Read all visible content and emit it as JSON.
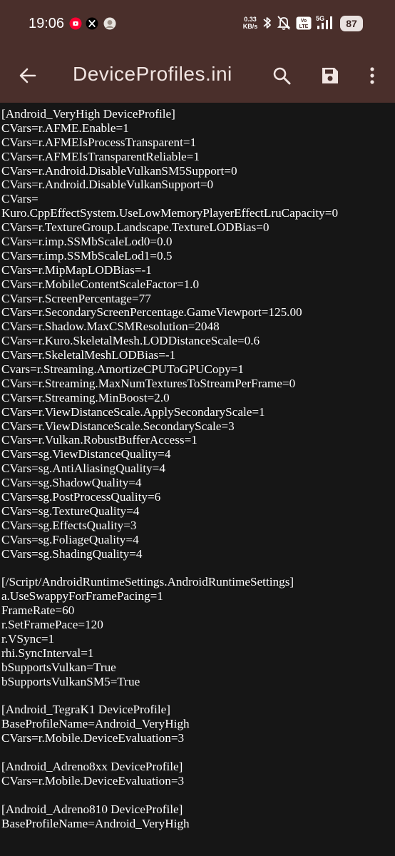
{
  "status_bar": {
    "time": "19:06",
    "net_speed_value": "0.33",
    "net_speed_unit": "KB/s",
    "signal_label": "5G",
    "volte_label": "Vo LTE",
    "battery": "87",
    "notification_icons": [
      "youtube-icon",
      "x-icon",
      "avatar-icon"
    ],
    "status_icons": [
      "bluetooth-icon",
      "mute-icon",
      "volte-icon",
      "5g-signal-icon",
      "battery-icon"
    ]
  },
  "app_bar": {
    "title": "DeviceProfiles.ini",
    "back_icon": "back-arrow-icon",
    "search_icon": "search-icon",
    "save_icon": "save-icon",
    "menu_icon": "more-vertical-icon"
  },
  "colors": {
    "bar_background": "#4a2f2b",
    "editor_background": "#161616",
    "text": "#ffffff",
    "youtube_red": "#ff0033"
  },
  "editor": {
    "lines": [
      "[Android_VeryHigh DeviceProfile]",
      "CVars=r.AFME.Enable=1",
      "CVars=r.AFMEIsProcessTransparent=1",
      "CVars=r.AFMEIsTransparentReliable=1",
      "CVars=r.Android.DisableVulkanSM5Support=0",
      "CVars=r.Android.DisableVulkanSupport=0",
      "CVars=",
      "Kuro.CppEffectSystem.UseLowMemoryPlayerEffectLruCapacity=0",
      "CVars=r.TextureGroup.Landscape.TextureLODBias=0",
      "CVars=r.imp.SSMbScaleLod0=0.0",
      "CVars=r.imp.SSMbScaleLod1=0.5",
      "CVars=r.MipMapLODBias=-1",
      "CVars=r.MobileContentScaleFactor=1.0",
      "CVars=r.ScreenPercentage=77",
      "CVars=r.SecondaryScreenPercentage.GameViewport=125.00",
      "CVars=r.Shadow.MaxCSMResolution=2048",
      "CVars=r.Kuro.SkeletalMesh.LODDistanceScale=0.6",
      "CVars=r.SkeletalMeshLODBias=-1",
      "Cvars=r.Streaming.AmortizeCPUToGPUCopy=1",
      "CVars=r.Streaming.MaxNumTexturesToStreamPerFrame=0",
      "CVars=r.Streaming.MinBoost=2.0",
      "CVars=r.ViewDistanceScale.ApplySecondaryScale=1",
      "CVars=r.ViewDistanceScale.SecondaryScale=3",
      "CVars=r.Vulkan.RobustBufferAccess=1",
      "CVars=sg.ViewDistanceQuality=4",
      "CVars=sg.AntiAliasingQuality=4",
      "CVars=sg.ShadowQuality=4",
      "CVars=sg.PostProcessQuality=6",
      "CVars=sg.TextureQuality=4",
      "CVars=sg.EffectsQuality=3",
      "CVars=sg.FoliageQuality=4",
      "CVars=sg.ShadingQuality=4",
      "",
      "[/Script/AndroidRuntimeSettings.AndroidRuntimeSettings]",
      "a.UseSwappyForFramePacing=1",
      "FrameRate=60",
      "r.SetFramePace=120",
      "r.VSync=1",
      "rhi.SyncInterval=1",
      "bSupportsVulkan=True",
      "bSupportsVulkanSM5=True",
      "",
      "[Android_TegraK1 DeviceProfile]",
      "BaseProfileName=Android_VeryHigh",
      "CVars=r.Mobile.DeviceEvaluation=3",
      "",
      "[Android_Adreno8xx DeviceProfile]",
      "CVars=r.Mobile.DeviceEvaluation=3",
      "",
      "[Android_Adreno810 DeviceProfile]",
      "BaseProfileName=Android_VeryHigh"
    ]
  }
}
